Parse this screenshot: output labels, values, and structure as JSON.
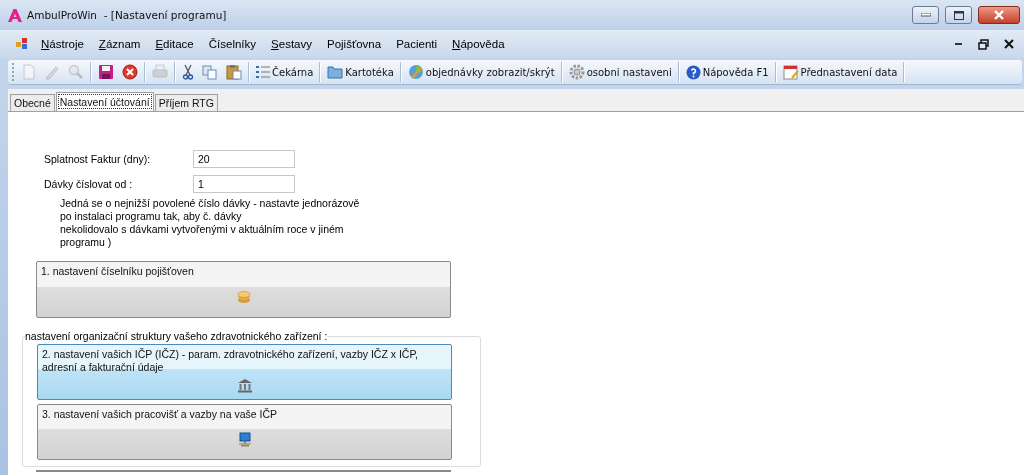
{
  "window": {
    "title": "AmbulProWin  - [Nastavení programu]"
  },
  "menu": [
    {
      "label": "Nástroje",
      "mnemonic": true
    },
    {
      "label": "Záznam",
      "mnemonic": true
    },
    {
      "label": "Editace",
      "mnemonic": true
    },
    {
      "label": "Číselníky",
      "mnemonic": false
    },
    {
      "label": "Sestavy",
      "mnemonic": true
    },
    {
      "label": "Pojišťovna",
      "mnemonic": false
    },
    {
      "label": "Pacienti",
      "mnemonic": false
    },
    {
      "label": "Nápověda",
      "mnemonic": true
    }
  ],
  "toolbar": [
    {
      "kind": "new",
      "disabled": true
    },
    {
      "kind": "edit",
      "disabled": true
    },
    {
      "kind": "search",
      "disabled": true
    },
    {
      "kind": "save",
      "disabled": false
    },
    {
      "kind": "cancel",
      "disabled": false
    },
    {
      "kind": "print",
      "disabled": true
    },
    {
      "kind": "cut",
      "disabled": false
    },
    {
      "kind": "copy",
      "disabled": false
    },
    {
      "kind": "paste",
      "disabled": false
    },
    {
      "kind": "list",
      "label": "Čekárna"
    },
    {
      "kind": "folder",
      "label": "Kartotéka"
    },
    {
      "kind": "orders",
      "label": "objednávky zobrazit/skrýt"
    },
    {
      "kind": "gear",
      "label": "osobni nastaveni"
    },
    {
      "kind": "help",
      "label": "Nápověda F1"
    },
    {
      "kind": "calendar",
      "label": "Přednastavení data"
    }
  ],
  "tabs": [
    {
      "label": "Obecné",
      "selected": false
    },
    {
      "label": "Nastavení účtování",
      "selected": true
    },
    {
      "label": "Příjem RTG",
      "selected": false
    }
  ],
  "fields": [
    {
      "label": "Splatnost Faktur (dny):",
      "value": "20"
    },
    {
      "label": "Dávky číslovat od :",
      "value": "1"
    }
  ],
  "note": [
    "Jedná se o nejnižší povolené číslo dávky - nastavte jednorázově",
    "po instalaci programu tak, aby č. dávky",
    "nekolidovalo s dávkami vytvořenými v aktuálním roce v jiném",
    "programu )"
  ],
  "settings_button": {
    "label": "1. nastavení číselníku pojišťoven",
    "kind": "coins",
    "highlighted": false
  },
  "group": {
    "legend": "nastavení organizační struktury vašeho zdravotnického zařízení :",
    "buttons": [
      {
        "label": "2. nastavení vašich IČP (IČZ) - param. zdravotnického zařízení, vazby IČZ x IČP, adresní a fakturační údaje",
        "kind": "bank",
        "highlighted": true
      },
      {
        "label": "3. nastavení vašich pracovišť a vazby na vaše IČP",
        "kind": "network",
        "highlighted": false
      }
    ]
  }
}
